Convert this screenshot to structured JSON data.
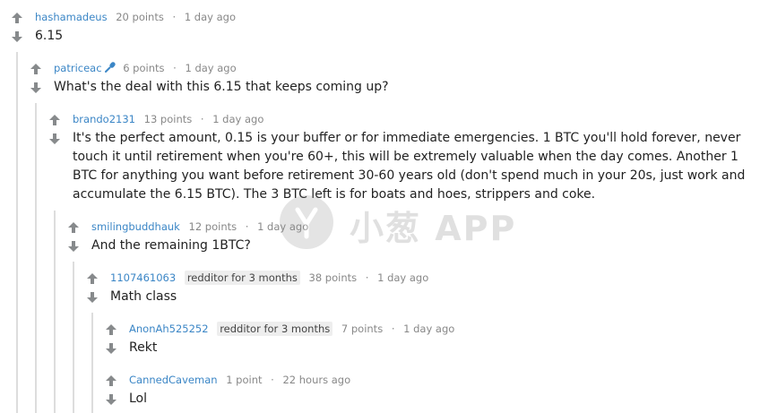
{
  "comments": [
    {
      "author": "hashamadeus",
      "points": "20 points",
      "sep": "·",
      "time": "1 day ago",
      "body": "6.15"
    },
    {
      "author": "patriceac",
      "points": "6 points",
      "sep": "·",
      "time": "1 day ago",
      "body": "What's the deal with this 6.15 that keeps coming up?"
    },
    {
      "author": "brando2131",
      "points": "13 points",
      "sep": "·",
      "time": "1 day ago",
      "body": "It's the perfect amount, 0.15 is your buffer or for immediate emergencies. 1 BTC you'll hold forever, never touch it until retirement when you're 60+, this will be extremely valuable when the day comes. Another 1 BTC for anything you want before retirement 30-60 years old (don't spend much in your 20s, just work and accumulate the 6.15 BTC). The 3 BTC left is for boats and hoes, strippers and coke."
    },
    {
      "author": "smilingbuddhauk",
      "points": "12 points",
      "sep": "·",
      "time": "1 day ago",
      "body": "And the remaining 1BTC?"
    },
    {
      "author": "1107461063",
      "flair": "redditor for 3 months",
      "points": "38 points",
      "sep": "·",
      "time": "1 day ago",
      "body": "Math class"
    },
    {
      "author": "AnonAh525252",
      "flair": "redditor for 3 months",
      "points": "7 points",
      "sep": "·",
      "time": "1 day ago",
      "body": "Rekt"
    },
    {
      "author": "CannedCaveman",
      "points": "1 point",
      "sep": "·",
      "time": "22 hours ago",
      "body": "Lol"
    }
  ],
  "watermark": {
    "text": "小葱 APP",
    "icon": "scallion-logo-icon"
  },
  "icons": {
    "upvote": "upvote-arrow-icon",
    "downvote": "downvote-arrow-icon",
    "mod": "microphone-icon"
  },
  "colors": {
    "arrow": "#878a8c",
    "author": "#3b86c6",
    "meta": "#888888",
    "flair_bg": "#eeeeee",
    "thread_line": "#dddddd"
  }
}
